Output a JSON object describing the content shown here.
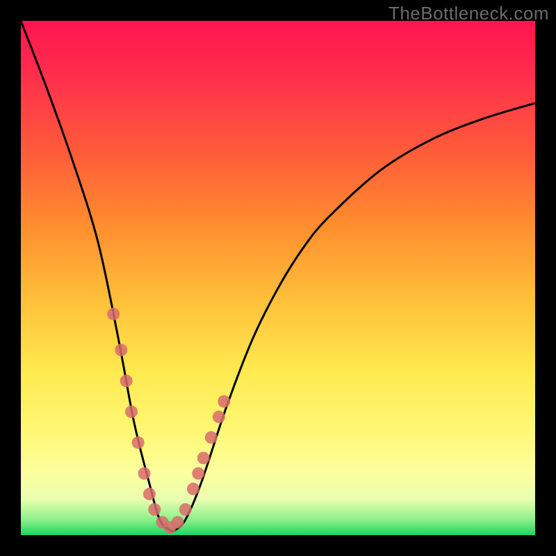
{
  "watermark": "TheBottleneck.com",
  "chart_data": {
    "type": "line",
    "title": "",
    "xlabel": "",
    "ylabel": "",
    "xlim": [
      0,
      100
    ],
    "ylim": [
      0,
      100
    ],
    "grid": false,
    "legend": false,
    "series": [
      {
        "name": "bottleneck-curve",
        "x": [
          0,
          5,
          10,
          15,
          19,
          22,
          25,
          27,
          29,
          30,
          32,
          35,
          40,
          45,
          50,
          55,
          60,
          70,
          80,
          90,
          100
        ],
        "values": [
          100,
          87,
          73,
          57,
          38,
          22,
          10,
          3,
          1,
          1,
          3,
          10,
          25,
          38,
          48,
          56,
          62,
          71,
          77,
          81,
          84
        ]
      }
    ],
    "highlight_points": {
      "name": "data-dots",
      "x": [
        18.0,
        19.5,
        20.5,
        21.5,
        22.8,
        24.0,
        25.0,
        26.0,
        27.5,
        29.0,
        30.5,
        32.0,
        33.5,
        34.5,
        35.5,
        37.0,
        38.5,
        39.5
      ],
      "values": [
        43.0,
        36.0,
        30.0,
        24.0,
        18.0,
        12.0,
        8.0,
        5.0,
        2.5,
        1.5,
        2.5,
        5.0,
        9.0,
        12.0,
        15.0,
        19.0,
        23.0,
        26.0
      ]
    },
    "background_gradient": [
      {
        "stop": 0.0,
        "color": "#ff1450"
      },
      {
        "stop": 0.4,
        "color": "#ff8e2e"
      },
      {
        "stop": 0.68,
        "color": "#ffe94f"
      },
      {
        "stop": 0.93,
        "color": "#e9ffb0"
      },
      {
        "stop": 1.0,
        "color": "#1ed463"
      }
    ]
  }
}
